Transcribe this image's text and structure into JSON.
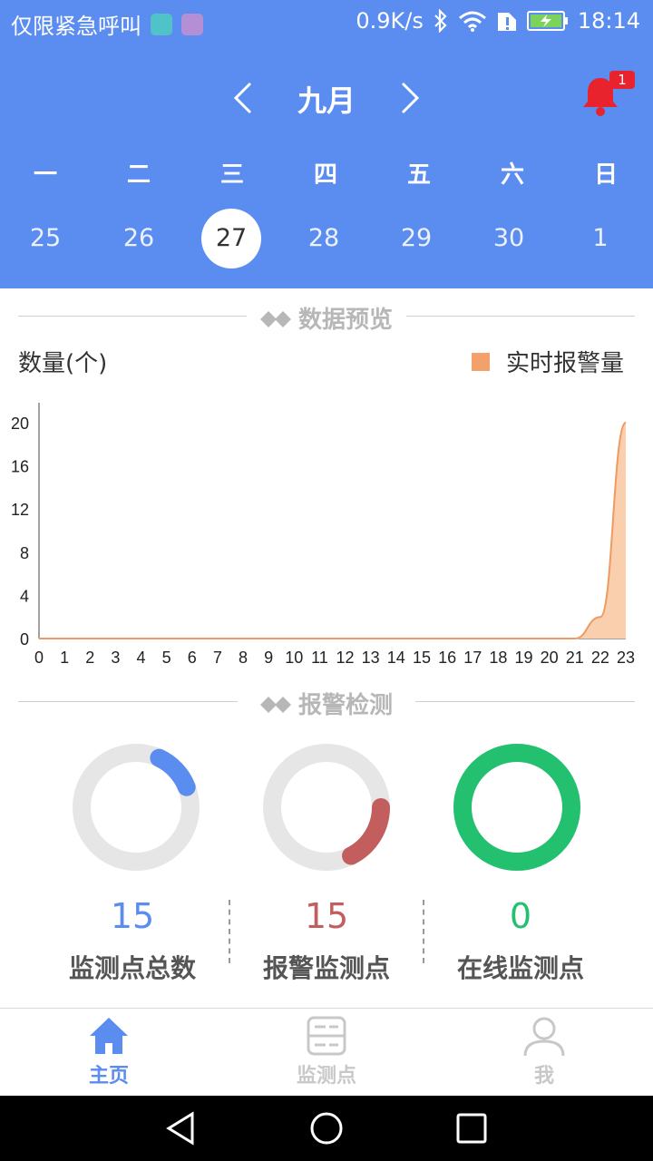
{
  "status_bar": {
    "left_text": "仅限紧急呼叫",
    "speed": "0.9K/s",
    "time": "18:14"
  },
  "calendar": {
    "month": "九月",
    "notification_count": "1",
    "weekdays": [
      "一",
      "二",
      "三",
      "四",
      "五",
      "六",
      "日"
    ],
    "dates": [
      "25",
      "26",
      "27",
      "28",
      "29",
      "30",
      "1"
    ],
    "selected_index": 2
  },
  "sections": {
    "overview_title": "数据预览",
    "alarm_title": "报警检测"
  },
  "chart_data": {
    "type": "area",
    "title": "",
    "ylabel": "数量(个)",
    "xlabel": "",
    "x": [
      0,
      1,
      2,
      3,
      4,
      5,
      6,
      7,
      8,
      9,
      10,
      11,
      12,
      13,
      14,
      15,
      16,
      17,
      18,
      19,
      20,
      21,
      22,
      23
    ],
    "series": [
      {
        "name": "实时报警量",
        "values": [
          0,
          0,
          0,
          0,
          0,
          0,
          0,
          0,
          0,
          0,
          0,
          0,
          0,
          0,
          0,
          0,
          0,
          0,
          0,
          0,
          0,
          0,
          2,
          20
        ]
      }
    ],
    "ylim": [
      0,
      20
    ],
    "yticks": [
      0,
      4,
      8,
      12,
      16,
      20
    ],
    "grid": false,
    "legend_position": "top-right",
    "colors": {
      "line": "#ee9a62",
      "fill": "#f9cfae",
      "legend": "#f4a06a"
    }
  },
  "stats": [
    {
      "value": "15",
      "label": "监测点总数",
      "color": "#5b8cf0",
      "fraction": 0.12
    },
    {
      "value": "15",
      "label": "报警监测点",
      "color": "#c25e5e",
      "fraction": 0.12
    },
    {
      "value": "0",
      "label": "在线监测点",
      "color": "#23c070",
      "fraction": 1.0
    }
  ],
  "bottom_nav": {
    "items": [
      {
        "label": "主页",
        "icon": "home-icon",
        "active": true
      },
      {
        "label": "监测点",
        "icon": "monitor-points-icon",
        "active": false
      },
      {
        "label": "我",
        "icon": "user-icon",
        "active": false
      }
    ]
  },
  "colors": {
    "primary": "#5b8cf0",
    "notification": "#e8232d"
  }
}
